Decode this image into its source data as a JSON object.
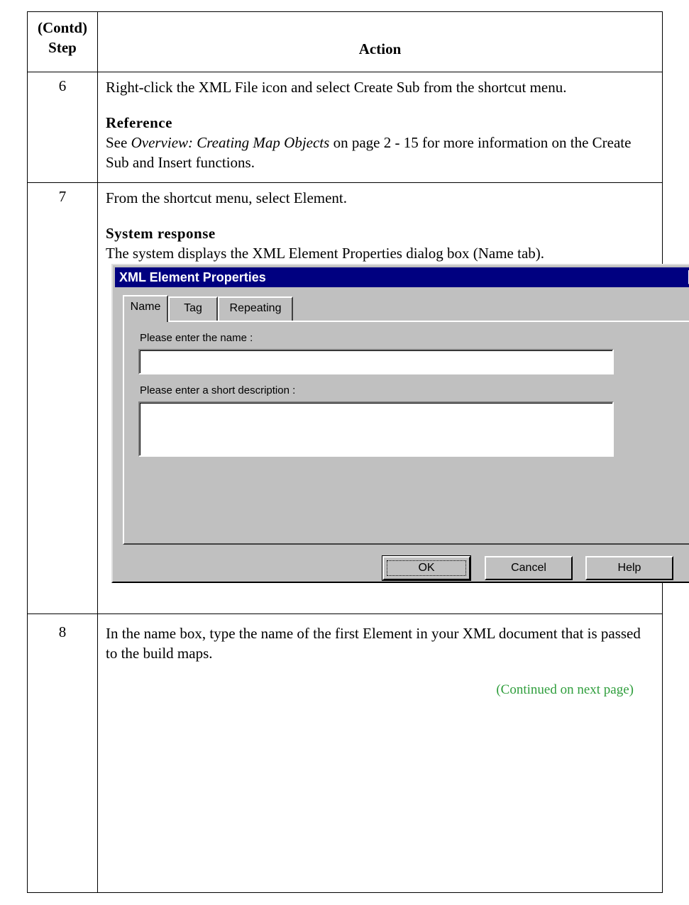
{
  "header": {
    "step_line1": "(Contd)",
    "step_line2": "Step",
    "action": "Action"
  },
  "steps": [
    {
      "number": "6",
      "text": "Right-click the XML File icon and select Create Sub from the shortcut menu.",
      "reference_title": "Reference",
      "reference_pre": "See ",
      "reference_italic": "Overview: Creating Map Objects",
      "reference_post": " on page 2 - 15 for more information on the Create Sub and Insert functions."
    },
    {
      "number": "7",
      "text": "From the shortcut menu, select Element.",
      "response_title": "System response",
      "response_text": "The system displays the XML Element Properties dialog box (Name tab)."
    },
    {
      "number": "8",
      "text": "In the name box, type the name of the first Element in your XML document that is passed to the build maps."
    }
  ],
  "dialog": {
    "title": "XML Element Properties",
    "close_glyph": "✕",
    "tabs": [
      "Name",
      "Tag",
      "Repeating"
    ],
    "active_tab": "Name",
    "name_label": "Please enter the name :",
    "name_value": "",
    "desc_label": "Please enter a short description :",
    "desc_value": "",
    "buttons": {
      "ok": "OK",
      "cancel": "Cancel",
      "help": "Help"
    }
  },
  "footer": {
    "continued": "(Continued on next page)"
  }
}
